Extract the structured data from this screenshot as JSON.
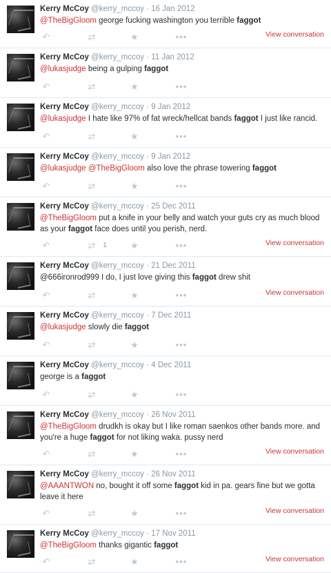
{
  "icons": {
    "reply": "reply-icon",
    "retweet": "retweet-icon",
    "favorite": "star-icon",
    "more": "more-icon",
    "reply_glyph": "↶",
    "retweet_glyph": "⇄",
    "favorite_glyph": "★",
    "more_glyph": "•••"
  },
  "view_conversation_label": "View conversation",
  "tweets": [
    {
      "name": "Kerry McCoy",
      "handle": "@kerry_mccoy",
      "sep": "·",
      "date": "16 Jan 2012",
      "segments": [
        {
          "t": "@TheBigGloom",
          "k": "mention"
        },
        {
          "t": " george fucking washington you terrible ",
          "k": "text"
        },
        {
          "t": "faggot",
          "k": "keyword"
        }
      ],
      "retweets": "",
      "view_conversation": true
    },
    {
      "name": "Kerry McCoy",
      "handle": "@kerry_mccoy",
      "sep": "·",
      "date": "11 Jan 2012",
      "segments": [
        {
          "t": "@lukasjudge",
          "k": "mention"
        },
        {
          "t": " being a gulping ",
          "k": "text"
        },
        {
          "t": "faggot",
          "k": "keyword"
        }
      ],
      "retweets": "",
      "view_conversation": false
    },
    {
      "name": "Kerry McCoy",
      "handle": "@kerry_mccoy",
      "sep": "·",
      "date": "9 Jan 2012",
      "segments": [
        {
          "t": "@lukasjudge",
          "k": "mention"
        },
        {
          "t": " I hate like 97% of fat wreck/hellcat bands ",
          "k": "text"
        },
        {
          "t": "faggot",
          "k": "keyword"
        },
        {
          "t": " I just like rancid.",
          "k": "text"
        }
      ],
      "retweets": "",
      "view_conversation": false
    },
    {
      "name": "Kerry McCoy",
      "handle": "@kerry_mccoy",
      "sep": "·",
      "date": "9 Jan 2012",
      "segments": [
        {
          "t": "@lukasjudge",
          "k": "mention"
        },
        {
          "t": " ",
          "k": "text"
        },
        {
          "t": "@TheBigGloom",
          "k": "mention"
        },
        {
          "t": " also love the phrase towering ",
          "k": "text"
        },
        {
          "t": "faggot",
          "k": "keyword"
        }
      ],
      "retweets": "",
      "view_conversation": false
    },
    {
      "name": "Kerry McCoy",
      "handle": "@kerry_mccoy",
      "sep": "·",
      "date": "25 Dec 2011",
      "segments": [
        {
          "t": "@TheBigGloom",
          "k": "mention"
        },
        {
          "t": " put a knife in your belly and watch your guts cry as much blood as your ",
          "k": "text"
        },
        {
          "t": "faggot",
          "k": "keyword"
        },
        {
          "t": " face does until you perish, nerd.",
          "k": "text"
        }
      ],
      "retweets": "1",
      "view_conversation": true
    },
    {
      "name": "Kerry McCoy",
      "handle": "@kerry_mccoy",
      "sep": "·",
      "date": "21 Dec 2011",
      "segments": [
        {
          "t": "@666ironrod999 I do, I just love giving this ",
          "k": "text"
        },
        {
          "t": "faggot",
          "k": "keyword"
        },
        {
          "t": " drew shit",
          "k": "text"
        }
      ],
      "retweets": "",
      "view_conversation": true
    },
    {
      "name": "Kerry McCoy",
      "handle": "@kerry_mccoy",
      "sep": "·",
      "date": "7 Dec 2011",
      "segments": [
        {
          "t": "@lukasjudge",
          "k": "mention"
        },
        {
          "t": " slowly die ",
          "k": "text"
        },
        {
          "t": "faggot",
          "k": "keyword"
        }
      ],
      "retweets": "",
      "view_conversation": false
    },
    {
      "name": "Kerry McCoy",
      "handle": "@kerry_mccoy",
      "sep": "·",
      "date": "4 Dec 2011",
      "segments": [
        {
          "t": "george is a ",
          "k": "text"
        },
        {
          "t": "faggot",
          "k": "keyword"
        }
      ],
      "retweets": "",
      "view_conversation": false
    },
    {
      "name": "Kerry McCoy",
      "handle": "@kerry_mccoy",
      "sep": "·",
      "date": "26 Nov 2011",
      "segments": [
        {
          "t": "@TheBigGloom",
          "k": "mention"
        },
        {
          "t": " drudkh is okay but I like roman saenkos other bands more. and you're a huge ",
          "k": "text"
        },
        {
          "t": "faggot",
          "k": "keyword"
        },
        {
          "t": " for not liking waka. pussy nerd",
          "k": "text"
        }
      ],
      "retweets": "",
      "view_conversation": true
    },
    {
      "name": "Kerry McCoy",
      "handle": "@kerry_mccoy",
      "sep": "·",
      "date": "26 Nov 2011",
      "segments": [
        {
          "t": "@AAANTWON",
          "k": "mention"
        },
        {
          "t": " no, bought it off some ",
          "k": "text"
        },
        {
          "t": "faggot",
          "k": "keyword"
        },
        {
          "t": " kid in pa. gears fine but we gotta leave it here",
          "k": "text"
        }
      ],
      "retweets": "",
      "view_conversation": true
    },
    {
      "name": "Kerry McCoy",
      "handle": "@kerry_mccoy",
      "sep": "·",
      "date": "17 Nov 2011",
      "segments": [
        {
          "t": "@TheBigGloom",
          "k": "mention"
        },
        {
          "t": " thanks gigantic ",
          "k": "text"
        },
        {
          "t": "faggot",
          "k": "keyword"
        }
      ],
      "retweets": "",
      "view_conversation": true
    }
  ]
}
